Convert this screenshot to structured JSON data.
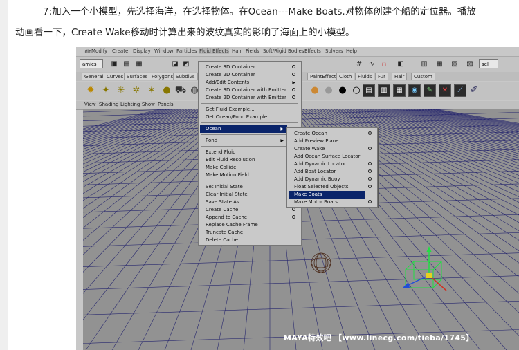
{
  "caption": {
    "line1": "7:加入一个小模型，先选择海洋，在选择物体。在Ocean---Make Boats.对物体创建个船的定位器。播放",
    "line2": "动画看一下，Create Wake移动时计算出来的波纹真实的影响了海面上的小模型。"
  },
  "menubar": [
    "ﾠdit",
    "Modify",
    "Create",
    "Display",
    "Window",
    "Particles",
    "Fluid Effects",
    "Hair",
    "Fields",
    "Soft/Rigid Bodies",
    "Effects",
    "Solvers",
    "Help"
  ],
  "toolbar": {
    "mode_select": "amics",
    "sel_label": "sel"
  },
  "shelf_tabs": [
    "General",
    "Curves",
    "Surfaces",
    "Polygons",
    "Subdivs",
    "PaintEffects",
    "Cloth",
    "Fluids",
    "Fur",
    "Hair",
    "Custom"
  ],
  "panel_menu": [
    "View",
    "Shading",
    "Lighting",
    "Show",
    "Panels"
  ],
  "fluid_menu": {
    "items": [
      {
        "label": "Create 3D Container",
        "option": true
      },
      {
        "label": "Create 2D Container",
        "option": true
      },
      {
        "label": "Add/Edit Contents",
        "submenu": true
      },
      {
        "label": "Create 3D Container with Emitter",
        "option": true
      },
      {
        "label": "Create 2D Container with Emitter",
        "option": true
      },
      {
        "label": "Get Fluid Example..."
      },
      {
        "label": "Get Ocean/Pond Example..."
      },
      {
        "label": "Ocean",
        "submenu": true,
        "highlight": true
      },
      {
        "label": "Pond",
        "submenu": true
      },
      {
        "label": "Extend Fluid",
        "option": true
      },
      {
        "label": "Edit Fluid Resolution",
        "option": true
      },
      {
        "label": "Make Collide",
        "option": true
      },
      {
        "label": "Make Motion Field"
      },
      {
        "label": "Set Initial State",
        "option": true
      },
      {
        "label": "Clear Initial State"
      },
      {
        "label": "Save State As...",
        "option": true
      },
      {
        "label": "Create Cache",
        "option": true
      },
      {
        "label": "Append to Cache",
        "option": true
      },
      {
        "label": "Replace Cache Frame"
      },
      {
        "label": "Truncate Cache"
      },
      {
        "label": "Delete Cache"
      }
    ]
  },
  "ocean_menu": {
    "items": [
      {
        "label": "Create Ocean",
        "option": true
      },
      {
        "label": "Add Preview Plane"
      },
      {
        "label": "Create Wake",
        "option": true
      },
      {
        "label": "Add Ocean Surface Locator"
      },
      {
        "label": "Add Dynamic Locator",
        "option": true
      },
      {
        "label": "Add Boat Locator",
        "option": true
      },
      {
        "label": "Add Dynamic Buoy",
        "option": true
      },
      {
        "label": "Float Selected Objects",
        "option": true
      },
      {
        "label": "Make Boats",
        "option": true,
        "highlight": true
      },
      {
        "label": "Make Motor Boats",
        "option": true
      }
    ]
  },
  "watermark": "MAYA特效吧  【www.linecg.com/tieba/1745】",
  "colors": {
    "menu_highlight": "#0a246a",
    "viewport_bg": "#929292",
    "grid_line": "#27276e",
    "manip_green": "#22dd44",
    "manip_blue": "#1f4ed8"
  }
}
